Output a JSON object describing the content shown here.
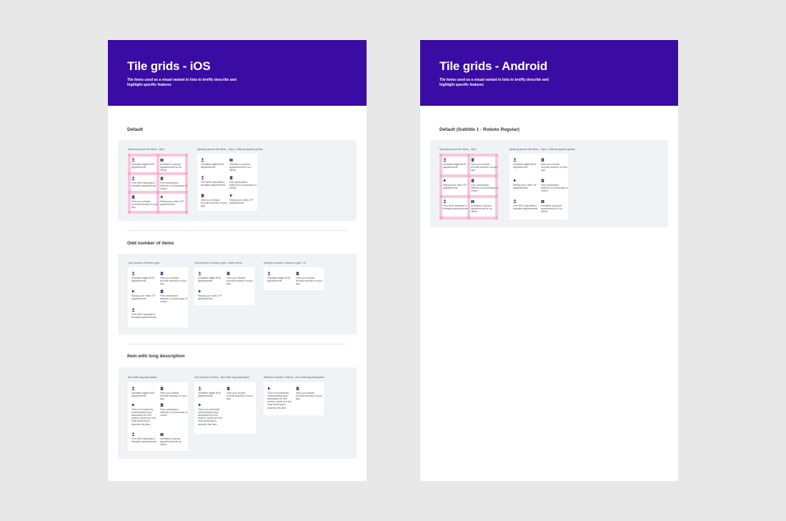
{
  "ios": {
    "title": "Tile grids - iOS",
    "subtitle": "Tile items used as a visual variant to lists to breifly describe and highlight specific features",
    "sections": {
      "default": "Default",
      "odd": "Odd number of items",
      "long": "Item with long description"
    },
    "captions": {
      "spacing_24": "Spacing around tile items - 24px",
      "spacing_24_noguides": "Spacing around tile items - 24px, | Without applied guides",
      "odd_grid": "Odd number of items in grid",
      "odd_grid_lesser": "Odd number of items in grid - lesser items",
      "min_grid": "Minimum number of items in grid - 2x",
      "long_desc": "Item with long description",
      "odd_long": "Odd number of items - item with long description",
      "min_long": "Minimum number of items - item with long description"
    }
  },
  "android": {
    "title": "Tile grids - Android",
    "subtitle": "Tile items used as a visual variant to lists to breifly describe and highlight specific features",
    "section_default": "Default (Subtitle 1 - Roboto Regular)",
    "captions": {
      "spacing_24": "Spacing around tile items - 24px",
      "spacing_24_noguides": "Spacing around tile items - 24px, | Without applied guides"
    }
  },
  "tiles": {
    "unlimited_gp": "Unlimited digital NHS appointments",
    "unlimited_clinic": "Unlimited in-person appointments at our clinics",
    "free_specialist": "Free NHS specialist & therapist appointments",
    "free_prescription": "Free prescription delivery to a pharmacy of choice",
    "view_records": "View your clinical records securely on your app",
    "replay_video": "Replay your video GP appointments",
    "long_text": "This is an extremely unnecessarily long description for this section, which isn't the most ideal way to describe this item."
  },
  "colors": {
    "header_bg": "#3a0ca3",
    "icon": "#2c2f7a",
    "panel_bg": "#f0f3f6",
    "guide": "#f496be"
  },
  "icons": [
    "person-icon",
    "clipboard-icon",
    "play-icon",
    "building-icon"
  ]
}
